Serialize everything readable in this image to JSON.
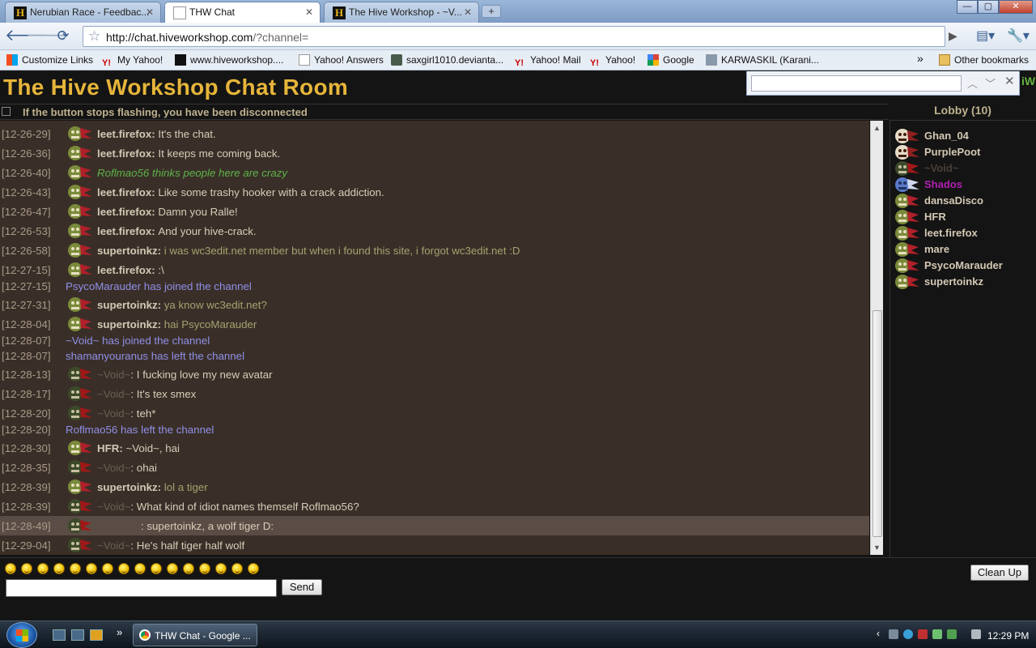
{
  "browser": {
    "tabs": [
      {
        "label": "Nerubian Race - Feedbac...",
        "active": false,
        "icon": "hive-favicon"
      },
      {
        "label": "THW Chat",
        "active": true,
        "icon": "page-icon"
      },
      {
        "label": "The Hive Workshop - ~V...",
        "active": false,
        "icon": "hive-favicon"
      }
    ],
    "new_tab": "+",
    "close_glyph": "✕",
    "url_host": "http://chat.hiveworkshop.com",
    "url_rest": "/?channel=",
    "bookmarks": [
      {
        "label": "Customize Links",
        "icon": "windows-icon"
      },
      {
        "label": "My Yahoo!",
        "icon": "yahoo-icon"
      },
      {
        "label": "www.hiveworkshop....",
        "icon": "hive-favicon"
      },
      {
        "label": "Yahoo! Answers",
        "icon": "page-icon"
      },
      {
        "label": "saxgirl1010.devianta...",
        "icon": "deviantart-icon"
      },
      {
        "label": "Yahoo! Mail",
        "icon": "yahoo-icon"
      },
      {
        "label": "Yahoo!",
        "icon": "yahoo-icon"
      },
      {
        "label": "Google",
        "icon": "google-icon"
      },
      {
        "label": "KARWASKIL (Karani...",
        "icon": "user-icon"
      }
    ],
    "more_bookmarks": "»",
    "other_bookmarks": "Other bookmarks"
  },
  "page": {
    "title": "The Hive Workshop Chat Room",
    "logo_text": "iW",
    "status_message": "If the button stops flashing, you have been disconnected"
  },
  "messages": [
    {
      "ts": "[12-26-29]",
      "type": "msg",
      "user": "leet.firefox:",
      "text": "It's the chat.",
      "avatar": "gnoll"
    },
    {
      "ts": "[12-26-36]",
      "type": "msg",
      "user": "leet.firefox:",
      "text": "It keeps me coming back.",
      "avatar": "gnoll"
    },
    {
      "ts": "[12-26-40]",
      "type": "action",
      "text": "Roflmao56 thinks people here are crazy",
      "avatar": "gnoll"
    },
    {
      "ts": "[12-26-43]",
      "type": "msg",
      "user": "leet.firefox:",
      "text": "Like some trashy hooker with a crack addiction.",
      "avatar": "gnoll"
    },
    {
      "ts": "[12-26-47]",
      "type": "msg",
      "user": "leet.firefox:",
      "text": "Damn you Ralle!",
      "avatar": "gnoll"
    },
    {
      "ts": "[12-26-53]",
      "type": "msg",
      "user": "leet.firefox:",
      "text": "And your hive-crack.",
      "avatar": "gnoll"
    },
    {
      "ts": "[12-26-58]",
      "type": "msg",
      "user": "supertoinkz:",
      "text": "i was wc3edit.net member but when i found this site, i forgot wc3edit.net :D",
      "avatar": "gnoll",
      "green": true
    },
    {
      "ts": "[12-27-15]",
      "type": "msg",
      "user": "leet.firefox:",
      "text": ":\\",
      "avatar": "gnoll"
    },
    {
      "ts": "[12-27-15]",
      "type": "sys",
      "text": "PsycoMarauder has joined the channel"
    },
    {
      "ts": "[12-27-31]",
      "type": "msg",
      "user": "supertoinkz:",
      "text": "ya know wc3edit.net?",
      "avatar": "gnoll",
      "green": true
    },
    {
      "ts": "[12-28-04]",
      "type": "msg",
      "user": "supertoinkz:",
      "text": "hai PsycoMarauder",
      "avatar": "gnoll",
      "green": true
    },
    {
      "ts": "[12-28-07]",
      "type": "sys",
      "text": "~Void~ has joined the channel"
    },
    {
      "ts": "[12-28-07]",
      "type": "sys",
      "text": "shamanyouranus has left the channel"
    },
    {
      "ts": "[12-28-13]",
      "type": "msg",
      "user": "~Void~",
      "void": true,
      "text": ": I fucking love my new avatar",
      "avatar": "orc"
    },
    {
      "ts": "[12-28-17]",
      "type": "msg",
      "user": "~Void~",
      "void": true,
      "text": ": It's tex smex",
      "avatar": "orc"
    },
    {
      "ts": "[12-28-20]",
      "type": "msg",
      "user": "~Void~",
      "void": true,
      "text": ": teh*",
      "avatar": "orc"
    },
    {
      "ts": "[12-28-20]",
      "type": "sys",
      "text": "Roflmao56 has left the channel"
    },
    {
      "ts": "[12-28-30]",
      "type": "msg",
      "user": "HFR:",
      "text": "~Void~, hai",
      "avatar": "gnoll"
    },
    {
      "ts": "[12-28-35]",
      "type": "msg",
      "user": "~Void~",
      "void": true,
      "text": ": ohai",
      "avatar": "orc"
    },
    {
      "ts": "[12-28-39]",
      "type": "msg",
      "user": "supertoinkz:",
      "text": "lol a tiger",
      "avatar": "gnoll",
      "green": true
    },
    {
      "ts": "[12-28-39]",
      "type": "msg",
      "user": "~Void~",
      "void": true,
      "text": ": What kind of idiot names themself Roflmao56?",
      "avatar": "orc"
    },
    {
      "ts": "[12-28-49]",
      "type": "msg",
      "user": "",
      "void": true,
      "text": ": supertoinkz, a wolf tiger D:",
      "avatar": "orc",
      "highlight": true
    },
    {
      "ts": "[12-29-04]",
      "type": "msg",
      "user": "~Void~",
      "void": true,
      "text": ": He's half tiger half wolf",
      "avatar": "orc"
    }
  ],
  "lobby": {
    "title": "Lobby (10)",
    "users": [
      {
        "name": "Ghan_04",
        "color": "#d4c8b4",
        "avatar": "skull"
      },
      {
        "name": "PurplePoot",
        "color": "#d4c8b4",
        "avatar": "skull"
      },
      {
        "name": "~Void~",
        "color": "#4a4038",
        "avatar": "orc"
      },
      {
        "name": "Shados",
        "color": "#b020b0",
        "avatar": "blue"
      },
      {
        "name": "dansaDisco",
        "color": "#d4c8b4",
        "avatar": "gnoll"
      },
      {
        "name": "HFR",
        "color": "#d4c8b4",
        "avatar": "gnoll"
      },
      {
        "name": "leet.firefox",
        "color": "#d4c8b4",
        "avatar": "gnoll"
      },
      {
        "name": "mare",
        "color": "#d4c8b4",
        "avatar": "gnoll"
      },
      {
        "name": "PsycoMarauder",
        "color": "#d4c8b4",
        "avatar": "gnoll"
      },
      {
        "name": "supertoinkz",
        "color": "#d4c8b4",
        "avatar": "gnoll"
      }
    ]
  },
  "controls": {
    "send_label": "Send",
    "cleanup_label": "Clean Up",
    "input_value": "",
    "smiley_count": 16
  },
  "taskbar": {
    "task_label": "THW Chat - Google ...",
    "clock": "12:29 PM",
    "more": "»"
  }
}
